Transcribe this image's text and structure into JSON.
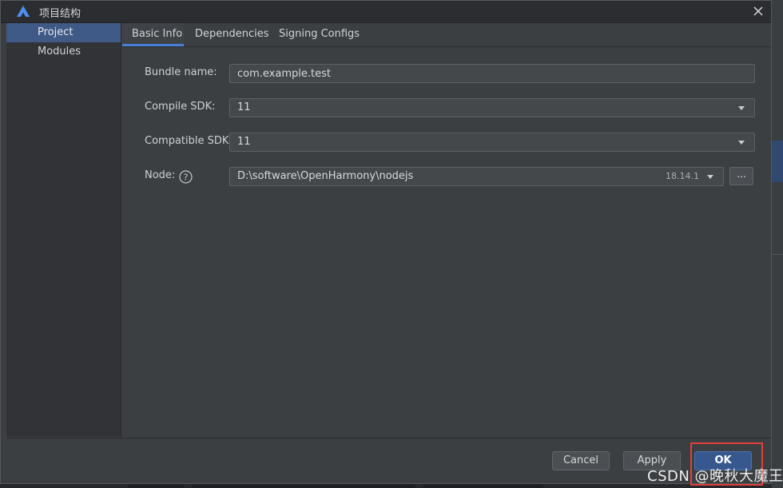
{
  "window": {
    "title": "项目结构",
    "icon": "harmony-app-icon",
    "close_icon": "close-icon"
  },
  "sidebar": {
    "items": [
      {
        "label": "Project"
      },
      {
        "label": "Modules"
      }
    ]
  },
  "tabs": [
    {
      "label": "Basic Info"
    },
    {
      "label": "Dependencies"
    },
    {
      "label": "Signing Configs"
    }
  ],
  "form": {
    "bundle_name": {
      "label": "Bundle name:",
      "value": "com.example.test"
    },
    "compile_sdk": {
      "label": "Compile SDK:",
      "value": "11"
    },
    "compatible_sdk": {
      "label": "Compatible SDK:",
      "value": "11"
    },
    "node": {
      "label": "Node:",
      "path": "D:\\software\\OpenHarmony\\nodejs",
      "version": "18.14.1",
      "browse_label": "..."
    }
  },
  "footer": {
    "cancel_label": "Cancel",
    "apply_label": "Apply",
    "ok_label": "OK"
  },
  "watermark": "CSDN @晚秋大魔王",
  "colors": {
    "accent": "#4a7fd8",
    "selection": "#3f5a86",
    "primary_button": "#36588e",
    "highlight": "#e0403a"
  }
}
